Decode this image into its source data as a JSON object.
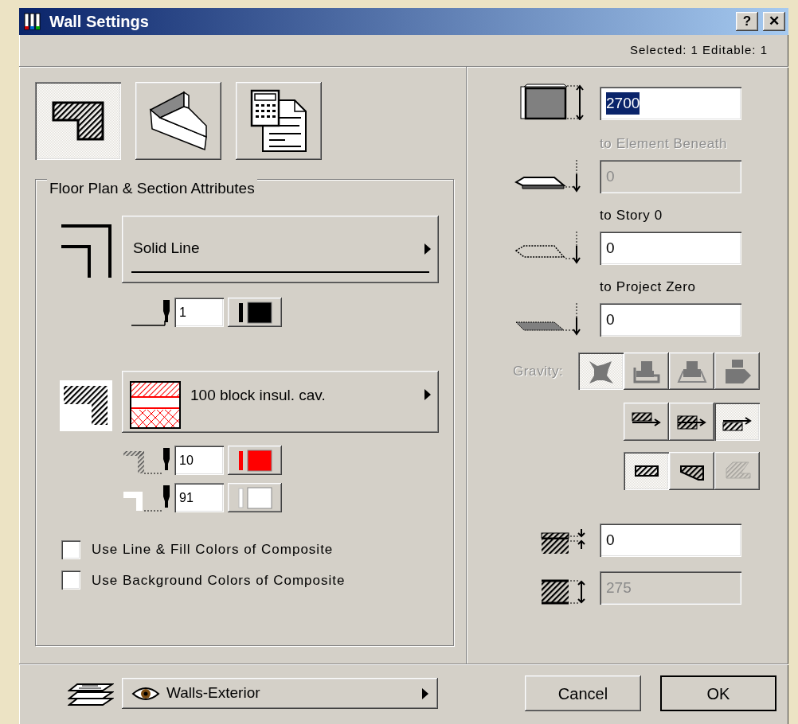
{
  "window": {
    "title": "Wall Settings",
    "help_label": "?",
    "close_label": "✕"
  },
  "selection_info": "Selected: 1 Editable: 1",
  "tabs": [
    {
      "kind": "floorplan",
      "selected": true
    },
    {
      "kind": "model",
      "selected": false
    },
    {
      "kind": "listing",
      "selected": false
    }
  ],
  "attributes_group": {
    "title": "Floor Plan & Section Attributes",
    "line_type": {
      "label": "Solid Line"
    },
    "line_pen": {
      "value": "1",
      "color": "#000000"
    },
    "fill": {
      "label": "100 block insul. cav."
    },
    "fill_pen": {
      "value": "10",
      "color": "#ff0000"
    },
    "background_pen": {
      "value": "91",
      "color": "#ffffff"
    },
    "checkboxes": [
      {
        "label": "Use Line & Fill Colors of Composite",
        "checked": false
      },
      {
        "label": "Use Background Colors of Composite",
        "checked": false
      }
    ]
  },
  "height_field": {
    "value": "2700",
    "text_selected": true
  },
  "elevations": [
    {
      "kind": "slab",
      "label": "to Element Beneath",
      "value": "0",
      "disabled": true
    },
    {
      "kind": "dotted",
      "label": "to Story 0",
      "value": "0",
      "disabled": false
    },
    {
      "kind": "filled",
      "label": "to Project Zero",
      "value": "0",
      "disabled": false
    }
  ],
  "gravity": {
    "label": "Gravity:",
    "disabled": true,
    "options": [
      {
        "kind": "zero",
        "selected": true
      },
      {
        "kind": "slab",
        "selected": false
      },
      {
        "kind": "floor",
        "selected": false
      },
      {
        "kind": "roof",
        "selected": false
      }
    ]
  },
  "reference_line": [
    {
      "kind": "outside",
      "selected": false
    },
    {
      "kind": "center",
      "selected": false
    },
    {
      "kind": "inside",
      "selected": true
    }
  ],
  "wall_shape": [
    {
      "kind": "straight",
      "selected": true,
      "disabled": false
    },
    {
      "kind": "trapezoid",
      "selected": false,
      "disabled": false
    },
    {
      "kind": "slanted",
      "selected": false,
      "disabled": true
    }
  ],
  "offset_field": {
    "value": "0",
    "disabled": false
  },
  "thickness_field": {
    "value": "275",
    "disabled": true
  },
  "layer": {
    "label": "Walls-Exterior",
    "visible": true
  },
  "buttons": [
    {
      "label": "Cancel",
      "default": false
    },
    {
      "label": "OK",
      "default": true
    }
  ]
}
